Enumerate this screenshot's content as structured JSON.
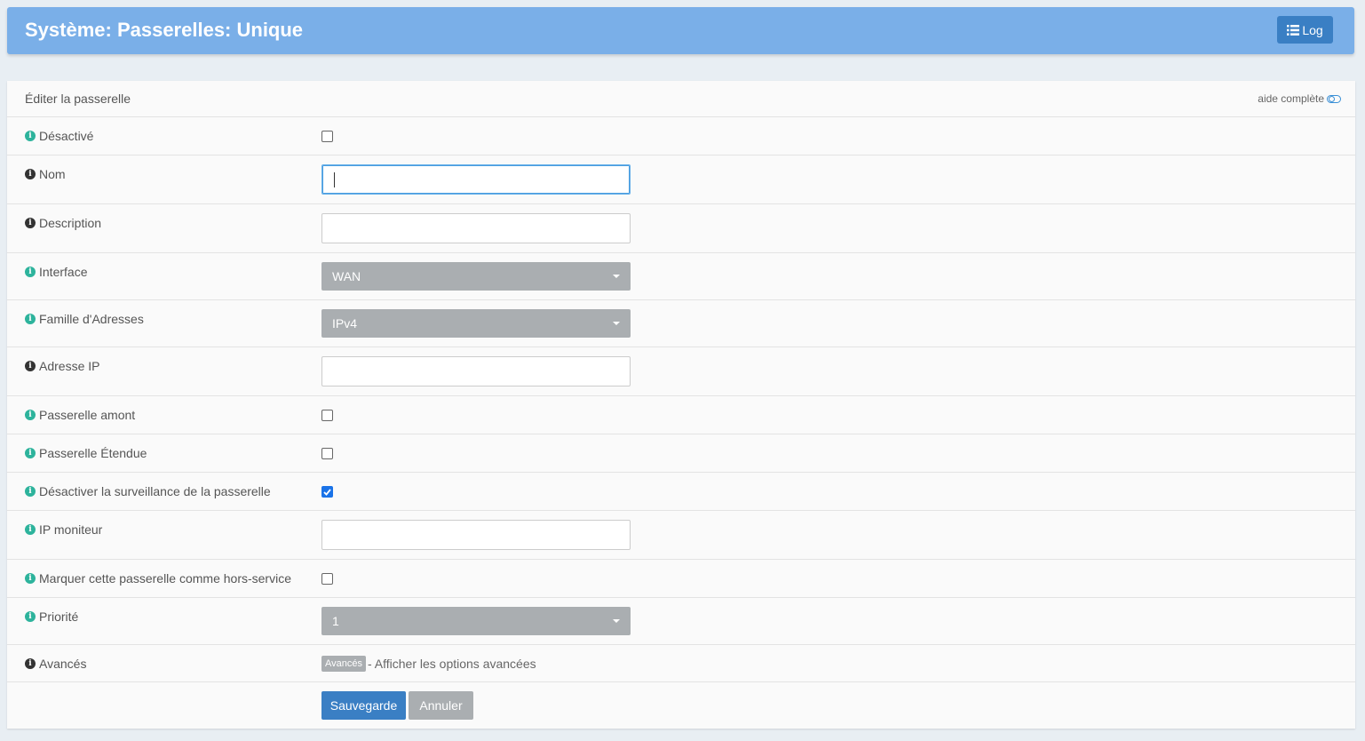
{
  "header": {
    "title": "Système: Passerelles: Unique",
    "log_label": "Log",
    "log_icon": "list-icon"
  },
  "panel": {
    "title": "Éditer la passerelle",
    "help_label": "aide complète"
  },
  "fields": {
    "disabled": {
      "label": "Désactivé",
      "checked": false
    },
    "name": {
      "label": "Nom",
      "value": ""
    },
    "description": {
      "label": "Description",
      "value": ""
    },
    "interface": {
      "label": "Interface",
      "value": "WAN"
    },
    "address_family": {
      "label": "Famille d'Adresses",
      "value": "IPv4"
    },
    "ip_address": {
      "label": "Adresse IP",
      "value": ""
    },
    "upstream": {
      "label": "Passerelle amont",
      "checked": false
    },
    "far_gateway": {
      "label": "Passerelle Étendue",
      "checked": false
    },
    "disable_monitoring": {
      "label": "Désactiver la surveillance de la passerelle",
      "checked": true
    },
    "monitor_ip": {
      "label": "IP moniteur",
      "value": ""
    },
    "force_down": {
      "label": "Marquer cette passerelle comme hors-service",
      "checked": false
    },
    "priority": {
      "label": "Priorité",
      "value": "1"
    },
    "advanced": {
      "label": "Avancés",
      "badge": "Avancés",
      "text": "- Afficher les options avancées"
    }
  },
  "actions": {
    "save_label": "Sauvegarde",
    "cancel_label": "Annuler"
  },
  "colors": {
    "header_bg": "#7aafe8",
    "primary": "#3a7fc4",
    "info_green": "#2db39c",
    "select_bg": "#aaaeb1"
  }
}
